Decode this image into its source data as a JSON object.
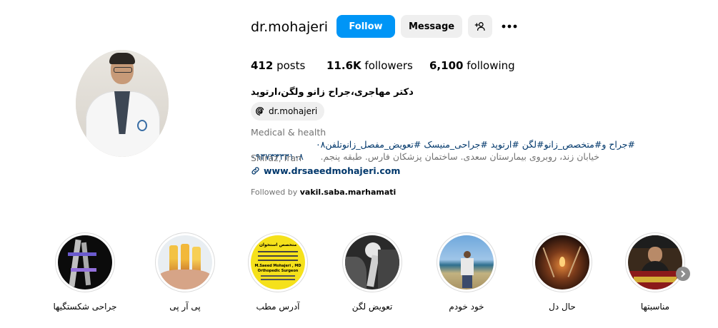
{
  "profile": {
    "username": "dr.mohajeri",
    "follow_label": "Follow",
    "message_label": "Message",
    "stats": {
      "posts_count": "412",
      "posts_label": "posts",
      "followers_count": "11.6K",
      "followers_label": "followers",
      "following_count": "6,100",
      "following_label": "following"
    },
    "bio": {
      "name": "دکتر مهاجری،جراح زانو ولگن،ارتوپد",
      "threads_handle": "dr.mohajeri",
      "category": "Medical & health",
      "hashtags": "#جراح و#متخصص_زانو#لگن #ارتوپد #جراحی_منیسک #تعویض_مفصل_زانوتلفن۰۸",
      "phone": "۰۹۳۷۳۳۳۳۱۰۸",
      "location": "Shiraz, Iran",
      "address": "خیابان زند، روبروی بیمارستان سعدی. ساختمان پزشکان فارس. طبقه پنجم.",
      "website": "www.drsaeedmohajeri.com",
      "followed_by_prefix": "Followed by",
      "followed_by_user": "vakil.saba.marhamati"
    }
  },
  "highlights": [
    {
      "label": "جراحی شکستگیها"
    },
    {
      "label": "پی آر پی"
    },
    {
      "label": "آدرس مطب",
      "card": {
        "line1": "متخصص استخوان",
        "line2": "M.Saeed Mohajeri , MD",
        "line3": "Orthopedic Surgeon"
      }
    },
    {
      "label": "تعویض لگن"
    },
    {
      "label": "خود خودم"
    },
    {
      "label": "حال دل"
    },
    {
      "label": "مناسبتها"
    }
  ],
  "icons": {
    "add_user": "person-plus-icon",
    "more": "more-horizontal-icon",
    "threads": "threads-icon",
    "link": "link-icon",
    "next": "chevron-right-icon"
  },
  "colors": {
    "accent": "#0095f6",
    "link": "#00376b",
    "secondary_text": "#737373",
    "button_gray": "#efefef"
  }
}
